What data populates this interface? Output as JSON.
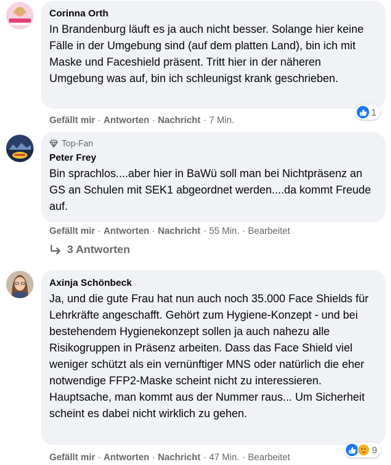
{
  "comments": [
    {
      "author": "Corinna Orth",
      "text": "In Brandenburg läuft es ja auch nicht besser. Solange hier keine Fälle in der Umgebung sind (auf dem platten Land), bin ich mit Maske und Faceshield präsent. Tritt hier in der näheren Umgebung was auf, bin ich schleunigst krank geschrieben.",
      "like_label": "Gefällt mir",
      "reply_label": "Antworten",
      "message_label": "Nachricht",
      "time": "7 Min.",
      "reaction_count": "1"
    },
    {
      "badge": "Top-Fan",
      "author": "Peter Frey",
      "text": "Bin sprachlos....aber hier in BaWü soll man bei Nichtpräsenz an GS an Schulen mit SEK1 abgeordnet werden....da kommt Freude auf.",
      "like_label": "Gefällt mir",
      "reply_label": "Antworten",
      "message_label": "Nachricht",
      "time": "55 Min.",
      "edited": "Bearbeitet"
    },
    {
      "author": "Axinja Schönbeck",
      "text": "Ja, und die gute Frau hat nun auch noch 35.000 Face Shields für Lehrkräfte angeschafft. Gehört zum Hygiene-Konzept - und bei bestehendem Hygienekonzept sollen ja auch nahezu alle Risikogruppen in Präsenz arbeiten. Dass das Face Shield viel weniger schützt als ein vernünftiger MNS oder natürlich die eher notwendige FFP2-Maske scheint nicht zu interessieren. Hauptsache, man kommt aus der Nummer raus... Um Sicherheit scheint es dabei nicht wirklich zu gehen.",
      "like_label": "Gefällt mir",
      "reply_label": "Antworten",
      "message_label": "Nachricht",
      "time": "47 Min.",
      "edited": "Bearbeitet",
      "reaction_count": "9"
    }
  ],
  "replies_link": "3 Antworten",
  "colors": {
    "bubble": "#f0f2f5",
    "meta": "#65676b",
    "like": "#1877f2"
  }
}
